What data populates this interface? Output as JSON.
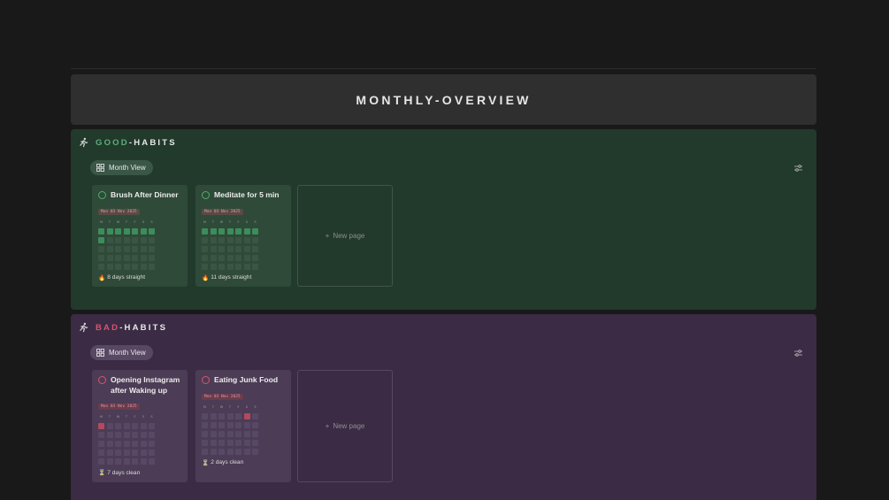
{
  "banner": {
    "title": "MONTHLY-OVERVIEW"
  },
  "good": {
    "title_accent": "GOOD",
    "title_rest": "-HABITS",
    "icon": "running-person-icon",
    "view_label": "Month View",
    "new_page_label": "New page",
    "cards": [
      {
        "title": "Brush After Dinner",
        "date": "Mon 03 Nov 2025",
        "streak": "8 days straight",
        "streak_icon": "fire-icon"
      },
      {
        "title": "Meditate for 5 min",
        "date": "Mon 03 Nov 2025",
        "streak": "11 days straight",
        "streak_icon": "fire-icon"
      }
    ]
  },
  "bad": {
    "title_accent": "BAD",
    "title_rest": "-HABITS",
    "icon": "running-person-icon",
    "view_label": "Month View",
    "new_page_label": "New page",
    "cards": [
      {
        "title": "Opening Instagram after Waking up",
        "date": "Mon 03 Nov 2025",
        "streak": "7 days clean",
        "streak_icon": "hourglass-icon"
      },
      {
        "title": "Eating Junk Food",
        "date": "Mon 03 Nov 2025",
        "streak": "2 days clean",
        "streak_icon": "hourglass-icon"
      }
    ]
  },
  "calendar": {
    "weekdays": [
      "M",
      "T",
      "W",
      "T",
      "F",
      "S",
      "S"
    ]
  },
  "colors": {
    "good_bg": "#223a2b",
    "bad_bg": "#3b2b45",
    "good_accent": "#5fae7c",
    "bad_accent": "#d9556a"
  }
}
